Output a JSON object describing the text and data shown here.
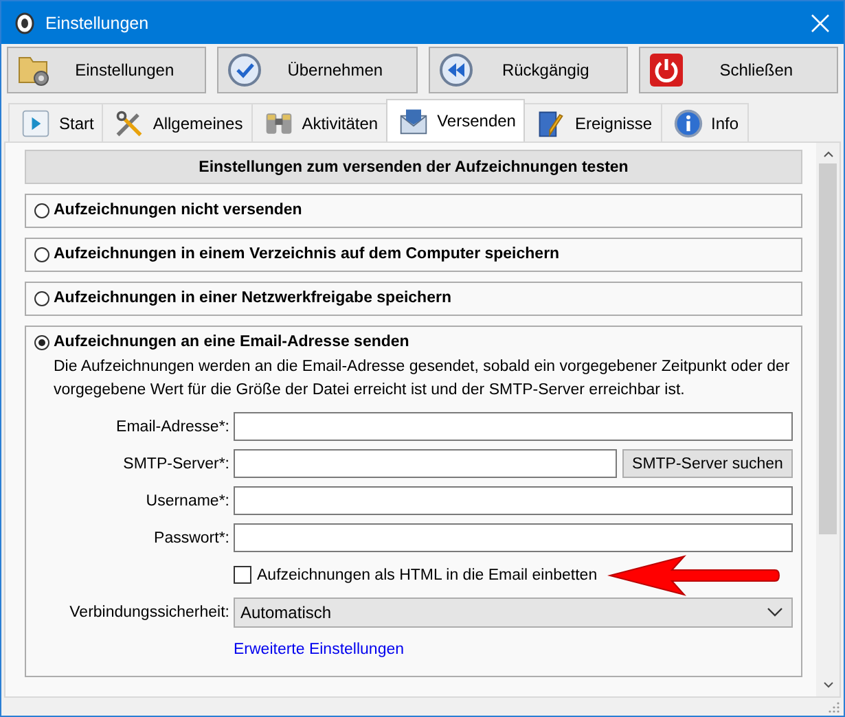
{
  "window": {
    "title": "Einstellungen"
  },
  "toolbar": [
    {
      "label": "Einstellungen",
      "kind": "folder"
    },
    {
      "label": "Übernehmen",
      "kind": "check"
    },
    {
      "label": "Rückgängig",
      "kind": "undo"
    },
    {
      "label": "Schließen",
      "kind": "power"
    }
  ],
  "tabs": [
    {
      "label": "Start",
      "kind": "play",
      "selected": false
    },
    {
      "label": "Allgemeines",
      "kind": "tools",
      "selected": false
    },
    {
      "label": "Aktivitäten",
      "kind": "binoculars",
      "selected": false
    },
    {
      "label": "Versenden",
      "kind": "mail",
      "selected": true
    },
    {
      "label": "Ereignisse",
      "kind": "doc",
      "selected": false
    },
    {
      "label": "Info",
      "kind": "info",
      "selected": false
    }
  ],
  "test_button": "Einstellungen zum versenden der Aufzeichnungen testen",
  "options": [
    {
      "label": "Aufzeichnungen nicht versenden",
      "selected": false
    },
    {
      "label": "Aufzeichnungen in einem Verzeichnis auf dem Computer speichern",
      "selected": false
    },
    {
      "label": "Aufzeichnungen in einer Netzwerkfreigabe speichern",
      "selected": false
    },
    {
      "label": "Aufzeichnungen an eine Email-Adresse senden",
      "selected": true
    }
  ],
  "email_section": {
    "description": "Die Aufzeichnungen werden an die Email-Adresse gesendet, sobald ein vorgegebener Zeitpunkt oder der vorgegebene Wert für die Größe der Datei erreicht ist und der SMTP-Server erreichbar ist.",
    "rows": [
      {
        "kind": "text",
        "label": "Email-Adresse*:"
      },
      {
        "kind": "text",
        "label": "SMTP-Server*:",
        "button": "SMTP-Server suchen"
      },
      {
        "kind": "text",
        "label": "Username*:"
      },
      {
        "kind": "text",
        "label": "Passwort*:"
      },
      {
        "kind": "checkbox",
        "text": "Aufzeichnungen als HTML in die Email einbetten",
        "checked": false
      },
      {
        "kind": "select",
        "label": "Verbindungssicherheit:",
        "value": "Automatisch"
      },
      {
        "kind": "link",
        "text": "Erweiterte Einstellungen"
      }
    ]
  }
}
